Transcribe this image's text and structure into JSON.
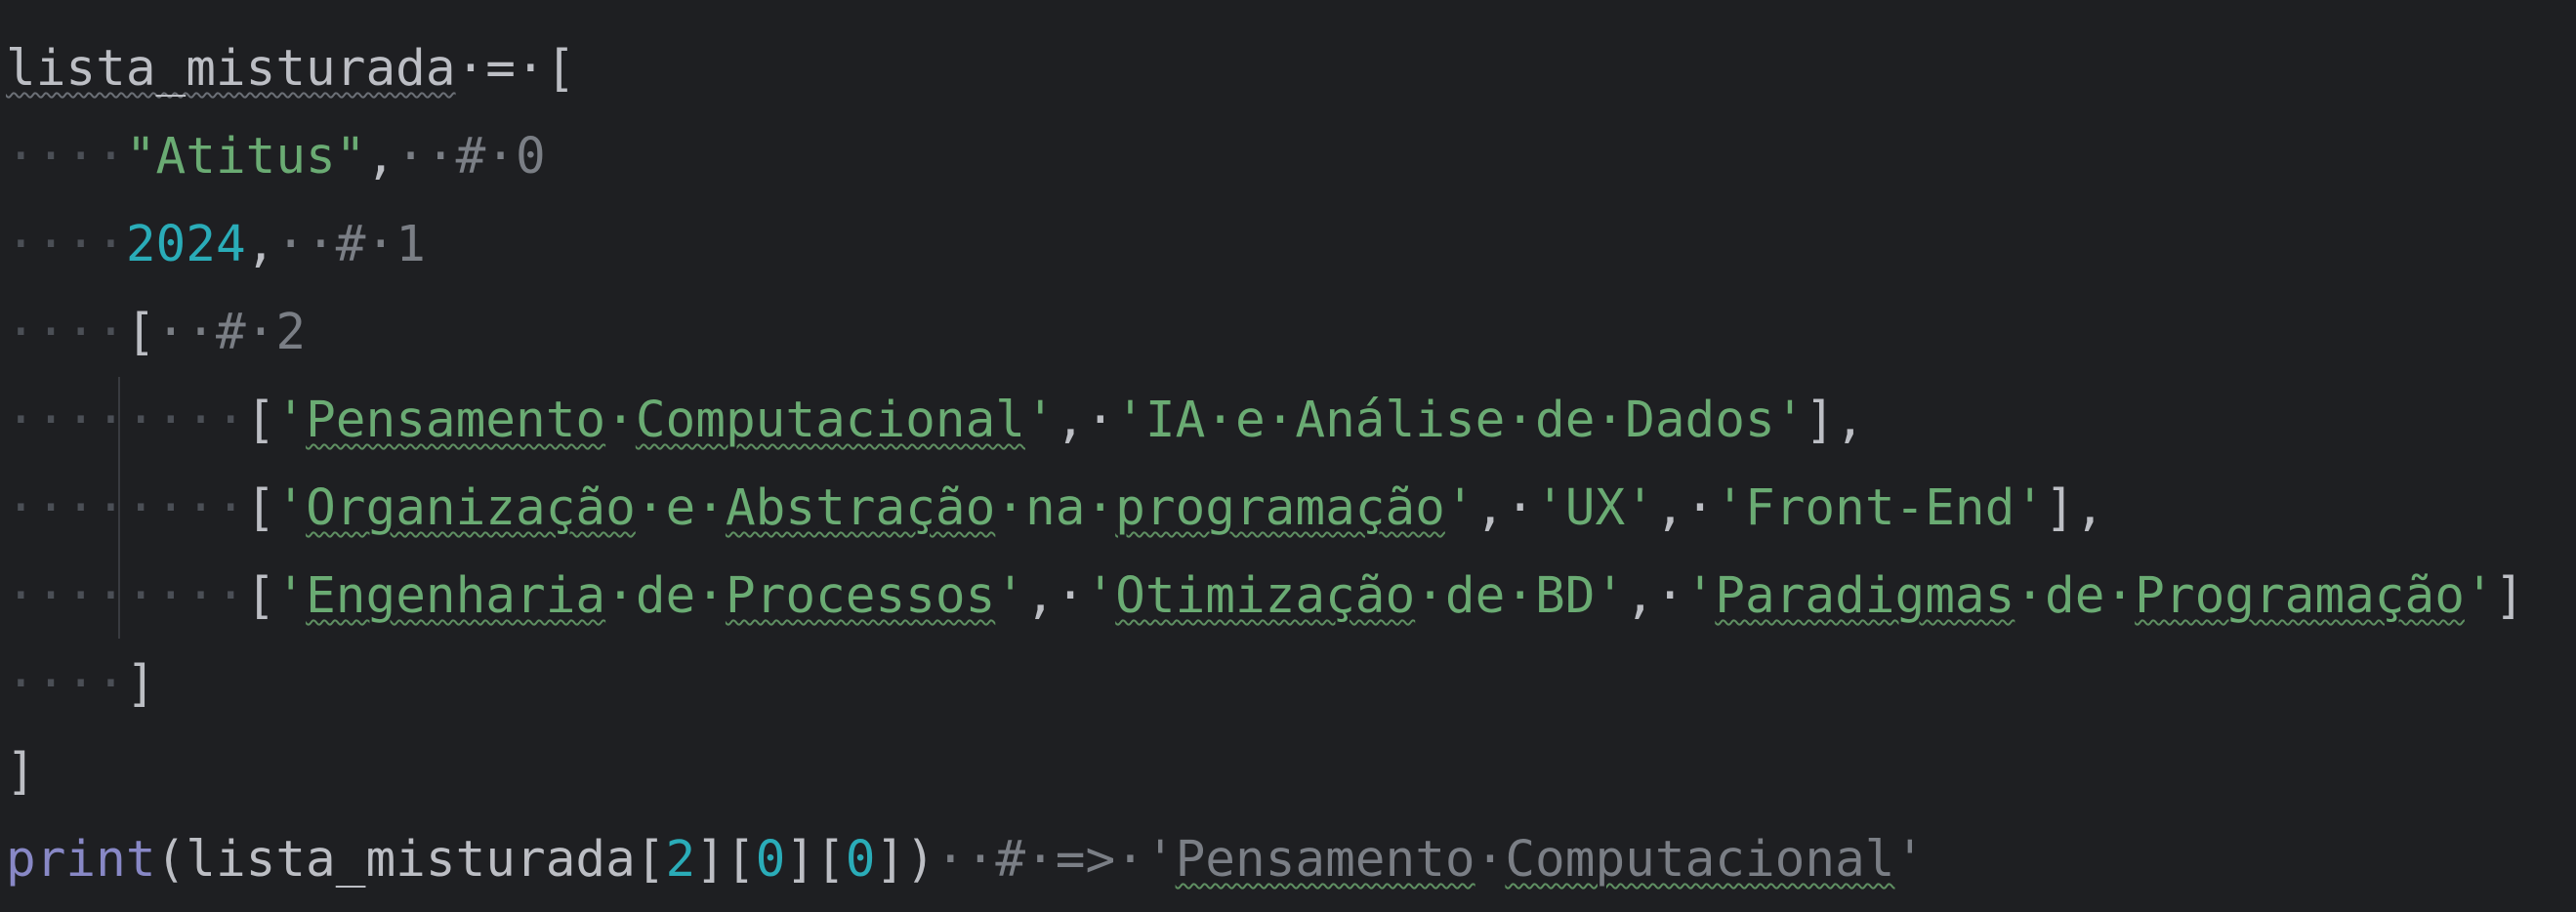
{
  "editor": {
    "lines": [
      [
        {
          "text": "lista_misturada",
          "kind": "plain",
          "squiggle": "ident"
        },
        {
          "text": "·=·[",
          "kind": "plain",
          "squiggle": ""
        }
      ],
      [
        {
          "text": "····",
          "kind": "ws",
          "squiggle": ""
        },
        {
          "text": "\"Atitus\"",
          "kind": "str",
          "squiggle": ""
        },
        {
          "text": ",",
          "kind": "plain",
          "squiggle": ""
        },
        {
          "text": "··#·0",
          "kind": "comment",
          "squiggle": ""
        }
      ],
      [
        {
          "text": "····",
          "kind": "ws",
          "squiggle": ""
        },
        {
          "text": "2024",
          "kind": "num",
          "squiggle": ""
        },
        {
          "text": ",",
          "kind": "plain",
          "squiggle": ""
        },
        {
          "text": "··#·1",
          "kind": "comment",
          "squiggle": ""
        }
      ],
      [
        {
          "text": "····",
          "kind": "ws",
          "squiggle": ""
        },
        {
          "text": "[",
          "kind": "plain",
          "squiggle": ""
        },
        {
          "text": "··#·2",
          "kind": "comment",
          "squiggle": ""
        }
      ],
      [
        {
          "text": "········",
          "kind": "ws",
          "squiggle": ""
        },
        {
          "text": "[",
          "kind": "plain",
          "squiggle": ""
        },
        {
          "text": "'",
          "kind": "str",
          "squiggle": ""
        },
        {
          "text": "Pensamento",
          "kind": "str",
          "squiggle": "str"
        },
        {
          "text": "·",
          "kind": "str",
          "squiggle": ""
        },
        {
          "text": "Computacional",
          "kind": "str",
          "squiggle": "str"
        },
        {
          "text": "'",
          "kind": "str",
          "squiggle": ""
        },
        {
          "text": ",·",
          "kind": "plain",
          "squiggle": ""
        },
        {
          "text": "'IA·e·Análise·de·Dados'",
          "kind": "str",
          "squiggle": ""
        },
        {
          "text": "],",
          "kind": "plain",
          "squiggle": ""
        }
      ],
      [
        {
          "text": "········",
          "kind": "ws",
          "squiggle": ""
        },
        {
          "text": "[",
          "kind": "plain",
          "squiggle": ""
        },
        {
          "text": "'",
          "kind": "str",
          "squiggle": ""
        },
        {
          "text": "Organização",
          "kind": "str",
          "squiggle": "str"
        },
        {
          "text": "·e·",
          "kind": "str",
          "squiggle": ""
        },
        {
          "text": "Abstração",
          "kind": "str",
          "squiggle": "str"
        },
        {
          "text": "·na·",
          "kind": "str",
          "squiggle": ""
        },
        {
          "text": "programação",
          "kind": "str",
          "squiggle": "str"
        },
        {
          "text": "'",
          "kind": "str",
          "squiggle": ""
        },
        {
          "text": ",·",
          "kind": "plain",
          "squiggle": ""
        },
        {
          "text": "'UX'",
          "kind": "str",
          "squiggle": ""
        },
        {
          "text": ",·",
          "kind": "plain",
          "squiggle": ""
        },
        {
          "text": "'Front-End'",
          "kind": "str",
          "squiggle": ""
        },
        {
          "text": "],",
          "kind": "plain",
          "squiggle": ""
        }
      ],
      [
        {
          "text": "········",
          "kind": "ws",
          "squiggle": ""
        },
        {
          "text": "[",
          "kind": "plain",
          "squiggle": ""
        },
        {
          "text": "'",
          "kind": "str",
          "squiggle": ""
        },
        {
          "text": "Engenharia",
          "kind": "str",
          "squiggle": "str"
        },
        {
          "text": "·de·",
          "kind": "str",
          "squiggle": ""
        },
        {
          "text": "Processos",
          "kind": "str",
          "squiggle": "str"
        },
        {
          "text": "'",
          "kind": "str",
          "squiggle": ""
        },
        {
          "text": ",·",
          "kind": "plain",
          "squiggle": ""
        },
        {
          "text": "'",
          "kind": "str",
          "squiggle": ""
        },
        {
          "text": "Otimização",
          "kind": "str",
          "squiggle": "str"
        },
        {
          "text": "·de·BD'",
          "kind": "str",
          "squiggle": ""
        },
        {
          "text": ",·",
          "kind": "plain",
          "squiggle": ""
        },
        {
          "text": "'",
          "kind": "str",
          "squiggle": ""
        },
        {
          "text": "Paradigmas",
          "kind": "str",
          "squiggle": "str"
        },
        {
          "text": "·de·",
          "kind": "str",
          "squiggle": ""
        },
        {
          "text": "Programação",
          "kind": "str",
          "squiggle": "str"
        },
        {
          "text": "'",
          "kind": "str",
          "squiggle": ""
        },
        {
          "text": "]",
          "kind": "plain",
          "squiggle": ""
        }
      ],
      [
        {
          "text": "····",
          "kind": "ws",
          "squiggle": ""
        },
        {
          "text": "]",
          "kind": "plain",
          "squiggle": ""
        }
      ],
      [
        {
          "text": "]",
          "kind": "plain",
          "squiggle": ""
        }
      ],
      [
        {
          "text": "print",
          "kind": "builtin",
          "squiggle": ""
        },
        {
          "text": "(lista_misturada[",
          "kind": "plain",
          "squiggle": ""
        },
        {
          "text": "2",
          "kind": "num",
          "squiggle": ""
        },
        {
          "text": "][",
          "kind": "plain",
          "squiggle": ""
        },
        {
          "text": "0",
          "kind": "num",
          "squiggle": ""
        },
        {
          "text": "][",
          "kind": "plain",
          "squiggle": ""
        },
        {
          "text": "0",
          "kind": "num",
          "squiggle": ""
        },
        {
          "text": "])",
          "kind": "plain",
          "squiggle": ""
        },
        {
          "text": "··#·=>·'",
          "kind": "comment",
          "squiggle": ""
        },
        {
          "text": "Pensamento",
          "kind": "comment",
          "squiggle": "str"
        },
        {
          "text": "·",
          "kind": "comment",
          "squiggle": ""
        },
        {
          "text": "Computacional",
          "kind": "comment",
          "squiggle": "str"
        },
        {
          "text": "'",
          "kind": "comment",
          "squiggle": ""
        }
      ]
    ]
  },
  "colors": {
    "background": "#1e1f22",
    "plain": "#bcbec4",
    "string": "#6aab73",
    "number": "#2aacb8",
    "comment": "#7a7e85",
    "builtin": "#8888c6",
    "whitespace_dots": "#4b4f56",
    "indent_guide": "#393b40"
  }
}
